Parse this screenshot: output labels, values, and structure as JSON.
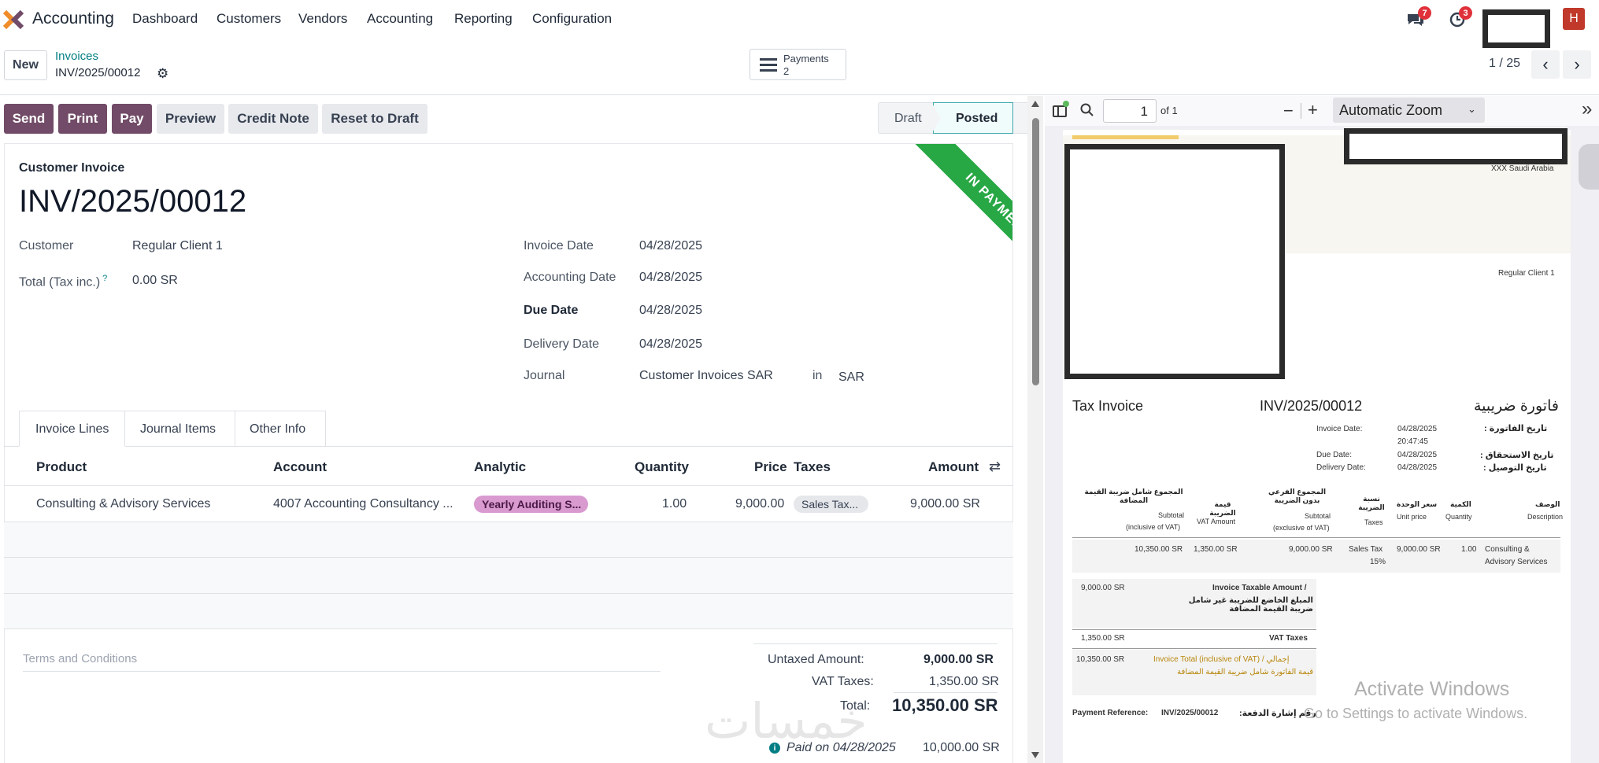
{
  "topbar": {
    "app_name": "Accounting",
    "menu": [
      "Dashboard",
      "Customers",
      "Vendors",
      "Accounting",
      "Reporting",
      "Configuration"
    ],
    "messages_badge": "7",
    "activities_badge": "3",
    "avatar_letter": "H"
  },
  "control": {
    "new_label": "New",
    "breadcrumb_parent": "Invoices",
    "record_name": "INV/2025/00012",
    "payments_label": "Payments",
    "payments_count": "2",
    "pager": "1 / 25"
  },
  "actions": {
    "send": "Send",
    "print": "Print",
    "pay": "Pay",
    "preview": "Preview",
    "credit_note": "Credit Note",
    "reset_to_draft": "Reset to Draft"
  },
  "status": {
    "draft": "Draft",
    "posted": "Posted",
    "ribbon": "IN PAYMENT"
  },
  "form": {
    "type_label": "Customer Invoice",
    "number": "INV/2025/00012",
    "customer_label": "Customer",
    "customer_value": "Regular Client 1",
    "total_label": "Total (Tax inc.)",
    "total_help": "?",
    "total_value": "0.00 SR",
    "invoice_date_label": "Invoice Date",
    "invoice_date": "04/28/2025",
    "accounting_date_label": "Accounting Date",
    "accounting_date": "04/28/2025",
    "due_date_label": "Due Date",
    "due_date": "04/28/2025",
    "delivery_date_label": "Delivery Date",
    "delivery_date": "04/28/2025",
    "journal_label": "Journal",
    "journal_value": "Customer Invoices SAR",
    "journal_in": "in",
    "journal_currency": "SAR"
  },
  "tabs": [
    "Invoice Lines",
    "Journal Items",
    "Other Info"
  ],
  "lines": {
    "headers": {
      "product": "Product",
      "account": "Account",
      "analytic": "Analytic",
      "quantity": "Quantity",
      "price": "Price",
      "taxes": "Taxes",
      "amount": "Amount"
    },
    "rows": [
      {
        "product": "Consulting & Advisory Services",
        "account": "4007 Accounting Consultancy ...",
        "analytic": "Yearly Auditing S...",
        "quantity": "1.00",
        "price": "9,000.00",
        "taxes": "Sales Tax...",
        "amount": "9,000.00 SR"
      }
    ]
  },
  "totals": {
    "terms_placeholder": "Terms and Conditions",
    "untaxed_label": "Untaxed Amount:",
    "untaxed_value": "9,000.00 SR",
    "vat_label": "VAT Taxes:",
    "vat_value": "1,350.00 SR",
    "total_label": "Total:",
    "total_value": "10,350.00 SR",
    "paid_label": "Paid on 04/28/2025",
    "paid_value": "10,000.00 SR"
  },
  "pdf_toolbar": {
    "page_value": "1",
    "page_of": "of 1",
    "zoom_minus": "−",
    "zoom_plus": "+",
    "zoom": "Automatic Zoom",
    "more": "»"
  },
  "pdf": {
    "company_country": "XXX Saudi Arabia",
    "client": "Regular Client 1",
    "title_en": "Tax Invoice",
    "number": "INV/2025/00012",
    "title_ar": "فاتورة ضريبية",
    "invoice_date_label": "Invoice Date:",
    "invoice_date": "04/28/2025",
    "invoice_time": "20:47:45",
    "invoice_date_ar": "تاريخ الفاتورة :",
    "due_date_label": "Due Date:",
    "due_date": "04/28/2025",
    "due_date_ar": "تاريخ الاستحقاق :",
    "delivery_date_label": "Delivery Date:",
    "delivery_date": "04/28/2025",
    "delivery_date_ar": "تاريخ التوصيل :",
    "col_subtotal_incl_ar": "المجموع شامل ضريبة القيمة المضافة",
    "col_subtotal_incl_en1": "Subtotal",
    "col_subtotal_incl_en2": "(inclusive of VAT)",
    "col_vat_ar": "قيمة الضريبة",
    "col_vat_en": "VAT Amount",
    "col_subtotal_excl_ar": "المجموع الفرعي بدون الضريبة",
    "col_subtotal_excl_en1": "Subtotal",
    "col_subtotal_excl_en2": "(exclusive of VAT)",
    "col_taxes_ar": "نسبة الضريبة",
    "col_taxes_en": "Taxes",
    "col_unit_ar": "سعر الوحدة",
    "col_unit_en": "Unit price",
    "col_qty_ar": "الكمية",
    "col_qty_en": "Quantity",
    "col_desc_ar": "الوصف",
    "col_desc_en": "Description",
    "row_subtotal_incl": "10,350.00 SR",
    "row_vat": "1,350.00 SR",
    "row_subtotal_excl": "9,000.00 SR",
    "row_taxes1": "Sales Tax",
    "row_taxes2": "15%",
    "row_unit": "9,000.00 SR",
    "row_qty": "1.00",
    "row_desc1": "Consulting &",
    "row_desc2": "Advisory Services",
    "taxable_value": "9,000.00 SR",
    "taxable_label": "Invoice Taxable Amount /",
    "taxable_ar": "المبلغ الخاضع للضريبة غير شامل ضريبة القيمة المضافة",
    "vat_value": "1,350.00 SR",
    "vat_label": "VAT Taxes",
    "total_value": "10,350.00 SR",
    "total_label": "Invoice Total (inclusive of VAT) / إجمالي",
    "total_ar": "قيمة الفاتورة شامل ضريبة القيمة المضافة",
    "payment_ref_label": "Payment Reference:",
    "payment_ref": "INV/2025/00012",
    "payment_ref_ar": "رقم إشارة الدفعة:"
  },
  "watermark": {
    "line1": "Activate Windows",
    "line2": "Go to Settings to activate Windows.",
    "logo_text": "خمسات"
  },
  "colors": {
    "primary": "#714b67",
    "teal": "#017e84",
    "ribbon": "#28a745",
    "badge": "#e0313a"
  }
}
